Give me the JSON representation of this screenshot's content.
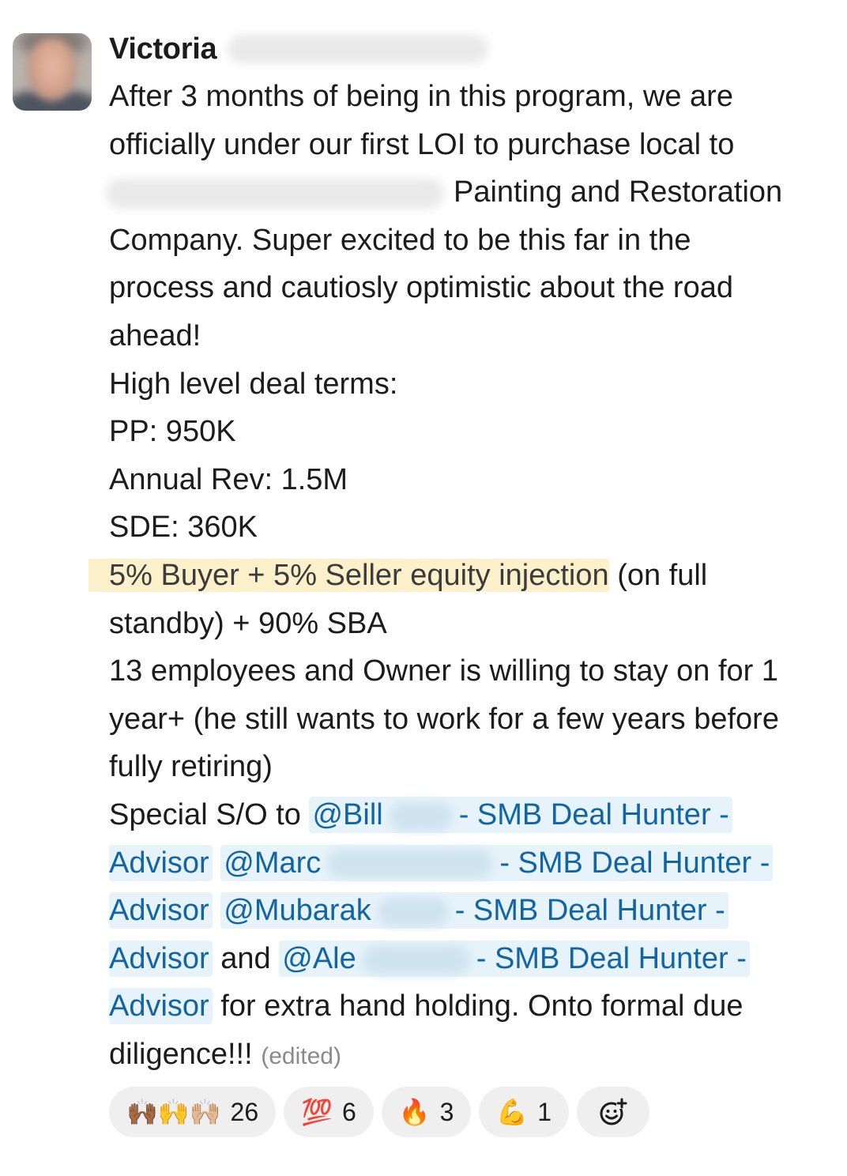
{
  "sender": {
    "name": "Victoria"
  },
  "message": {
    "lines": [
      "After 3 months of being in this program, we are",
      "officially under our first LOI to purchase local to",
      "Painting and Restoration",
      "Company. Super excited to be this far in the",
      "process and cautiosly optimistic about the road",
      "ahead!",
      "High level deal terms:",
      "PP: 950K",
      "Annual Rev: 1.5M",
      "SDE: 360K"
    ],
    "highlight": "5% Buyer + 5% Seller equity injection",
    "highlight_rest": "(on full",
    "standby_line": "standby) + 90% SBA",
    "employees_lines": [
      "13 employees and Owner is willing to stay on for 1",
      "year+ (he still wants to work for a few years before",
      "fully retiring)"
    ],
    "shoutout_prefix": "Special S/O to",
    "mentions": [
      {
        "name": "@Bill",
        "suffix": "- SMB Deal Hunter -",
        "role": "Advisor"
      },
      {
        "name": "@Marc",
        "suffix": "- SMB Deal Hunter -",
        "role": "Advisor"
      },
      {
        "name": "@Mubarak",
        "suffix": "- SMB Deal Hunter -",
        "role": "Advisor"
      },
      {
        "name": "@Ale",
        "suffix": "- SMB Deal Hunter -",
        "role": "Advisor"
      }
    ],
    "and_word": "and",
    "closing_mid": "for extra hand holding. Onto formal due",
    "closing_end": "diligence!!!",
    "edited": "(edited)"
  },
  "reactions": [
    {
      "emoji": "🙌🏾🙌🙌🏼",
      "icon": "raised-hands-icon",
      "count": "26"
    },
    {
      "emoji": "💯",
      "icon": "hundred-points-icon",
      "count": "6"
    },
    {
      "emoji": "🔥",
      "icon": "fire-icon",
      "count": "3"
    },
    {
      "emoji": "💪",
      "icon": "flexed-biceps-icon",
      "count": "1"
    }
  ],
  "add_reaction_icon": "add-reaction-icon",
  "colors": {
    "mention_text": "#1264a3",
    "mention_bg": "#e6f3fa",
    "highlight_bg": "#fdf1cb",
    "reaction_bg": "#efefef"
  }
}
